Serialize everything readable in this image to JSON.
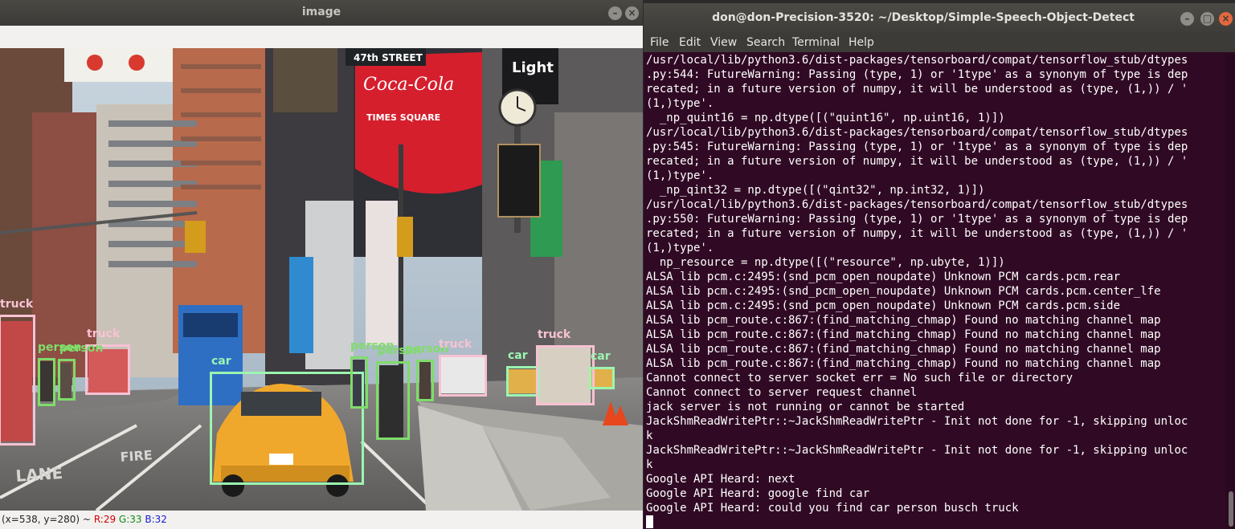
{
  "image_window": {
    "title": "image",
    "status": {
      "coords": "(x=538, y=280) ~",
      "r": "R:29",
      "g": "G:33",
      "b": "B:32"
    },
    "scene_signs": {
      "coca_cola": "Coca-Cola",
      "times_square": "TIMES SQUARE",
      "street": "47th STREET",
      "light": "Light",
      "lane": "LANE",
      "fire": "FIRE"
    },
    "detections": [
      {
        "label": "truck",
        "cls": "truck"
      },
      {
        "label": "truck",
        "cls": "truck"
      },
      {
        "label": "car",
        "cls": "car"
      },
      {
        "label": "person",
        "cls": "person"
      },
      {
        "label": "person",
        "cls": "person"
      },
      {
        "label": "person",
        "cls": "person"
      },
      {
        "label": "person",
        "cls": "person"
      },
      {
        "label": "person",
        "cls": "person"
      },
      {
        "label": "truck",
        "cls": "truck"
      },
      {
        "label": "car",
        "cls": "car"
      },
      {
        "label": "truck",
        "cls": "truck"
      },
      {
        "label": "car",
        "cls": "car"
      }
    ]
  },
  "terminal": {
    "title": "don@don-Precision-3520: ~/Desktop/Simple-Speech-Object-Detect",
    "menu": [
      "File",
      "Edit",
      "View",
      "Search",
      "Terminal",
      "Help"
    ],
    "lines": [
      "/usr/local/lib/python3.6/dist-packages/tensorboard/compat/tensorflow_stub/dtypes",
      ".py:544: FutureWarning: Passing (type, 1) or '1type' as a synonym of type is dep",
      "recated; in a future version of numpy, it will be understood as (type, (1,)) / '",
      "(1,)type'.",
      "  _np_quint16 = np.dtype([(\"quint16\", np.uint16, 1)])",
      "/usr/local/lib/python3.6/dist-packages/tensorboard/compat/tensorflow_stub/dtypes",
      ".py:545: FutureWarning: Passing (type, 1) or '1type' as a synonym of type is dep",
      "recated; in a future version of numpy, it will be understood as (type, (1,)) / '",
      "(1,)type'.",
      "  _np_qint32 = np.dtype([(\"qint32\", np.int32, 1)])",
      "/usr/local/lib/python3.6/dist-packages/tensorboard/compat/tensorflow_stub/dtypes",
      ".py:550: FutureWarning: Passing (type, 1) or '1type' as a synonym of type is dep",
      "recated; in a future version of numpy, it will be understood as (type, (1,)) / '",
      "(1,)type'.",
      "  np_resource = np.dtype([(\"resource\", np.ubyte, 1)])",
      "ALSA lib pcm.c:2495:(snd_pcm_open_noupdate) Unknown PCM cards.pcm.rear",
      "ALSA lib pcm.c:2495:(snd_pcm_open_noupdate) Unknown PCM cards.pcm.center_lfe",
      "ALSA lib pcm.c:2495:(snd_pcm_open_noupdate) Unknown PCM cards.pcm.side",
      "ALSA lib pcm_route.c:867:(find_matching_chmap) Found no matching channel map",
      "ALSA lib pcm_route.c:867:(find_matching_chmap) Found no matching channel map",
      "ALSA lib pcm_route.c:867:(find_matching_chmap) Found no matching channel map",
      "ALSA lib pcm_route.c:867:(find_matching_chmap) Found no matching channel map",
      "Cannot connect to server socket err = No such file or directory",
      "Cannot connect to server request channel",
      "jack server is not running or cannot be started",
      "JackShmReadWritePtr::~JackShmReadWritePtr - Init not done for -1, skipping unloc",
      "k",
      "JackShmReadWritePtr::~JackShmReadWritePtr - Init not done for -1, skipping unloc",
      "k",
      "Google API Heard: next",
      "Google API Heard: google find car",
      "Google API Heard: could you find car person busch truck"
    ]
  }
}
